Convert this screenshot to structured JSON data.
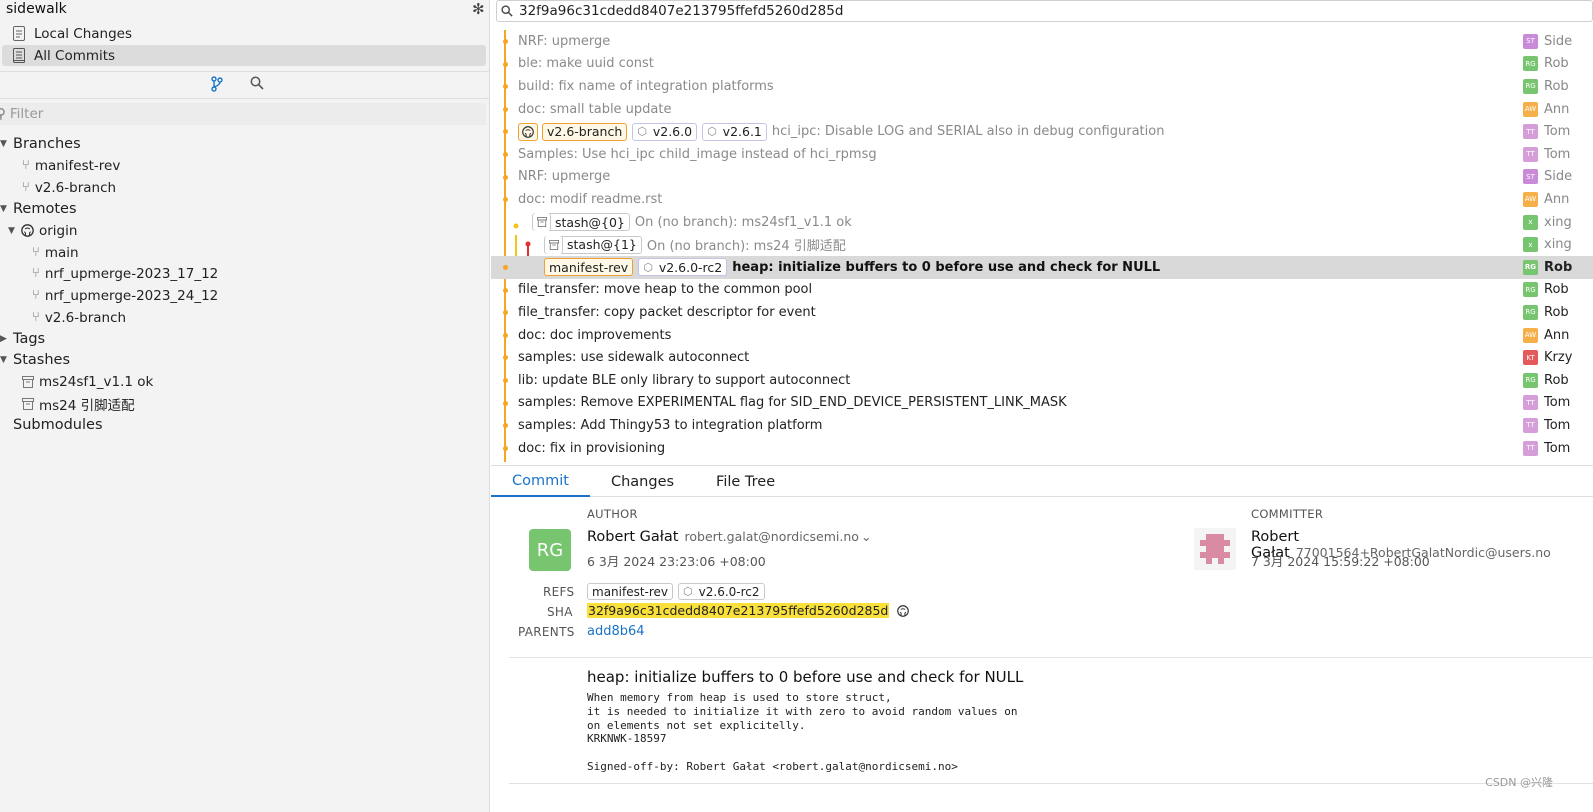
{
  "sidebar": {
    "repo_name": "sidewalk",
    "nav": [
      {
        "label": "Local Changes"
      },
      {
        "label": "All Commits"
      }
    ],
    "filter_placeholder": "Filter",
    "branches_label": "Branches",
    "branches": [
      "manifest-rev",
      "v2.6-branch"
    ],
    "remotes_label": "Remotes",
    "origin_label": "origin",
    "remote_branches": [
      "main",
      "nrf_upmerge-2023_17_12",
      "nrf_upmerge-2023_24_12",
      "v2.6-branch"
    ],
    "tags_label": "Tags",
    "stashes_label": "Stashes",
    "stashes": [
      "ms24sf1_v1.1 ok",
      "ms24 引脚适配"
    ],
    "submodules_label": "Submodules"
  },
  "search": {
    "value": "32f9a96c31cdedd8407e213795ffefd5260d285d"
  },
  "commits": [
    {
      "subject": "NRF: upmerge",
      "author": "Side",
      "initials": "ST",
      "color": "#c98bd8"
    },
    {
      "subject": "ble: make uuid const",
      "author": "Rob",
      "initials": "RG",
      "color": "#77c66f"
    },
    {
      "subject": "build: fix name of integration platforms",
      "author": "Rob",
      "initials": "RG",
      "color": "#77c66f"
    },
    {
      "subject": "doc: small table update",
      "author": "Ann",
      "initials": "AW",
      "color": "#f5b04a"
    },
    {
      "subject": "hci_ipc: Disable LOG and SERIAL also in debug configuration",
      "author": "Tom",
      "initials": "TT",
      "color": "#d59ed8",
      "refs": {
        "branch": "v2.6-branch",
        "tag1": "v2.6.0",
        "tag2": "v2.6.1"
      }
    },
    {
      "subject": "Samples: Use hci_ipc child_image instead of hci_rpmsg",
      "author": "Tom",
      "initials": "TT",
      "color": "#d59ed8"
    },
    {
      "subject": "NRF: upmerge",
      "author": "Side",
      "initials": "ST",
      "color": "#c98bd8"
    },
    {
      "subject": "doc: modif readme.rst",
      "author": "Ann",
      "initials": "AW",
      "color": "#f5b04a"
    },
    {
      "subject": "On (no branch): ms24sf1_v1.1 ok",
      "author": "xing",
      "initials": "x",
      "color": "#77c66f",
      "stash": "stash@{0}"
    },
    {
      "subject": "On (no branch): ms24 引脚适配",
      "author": "xing",
      "initials": "x",
      "color": "#77c66f",
      "stash": "stash@{1}"
    },
    {
      "subject": "heap: initialize buffers to 0 before use and check for NULL",
      "author": "Rob",
      "initials": "RG",
      "color": "#77c66f",
      "refs": {
        "branch": "manifest-rev",
        "tag1": "v2.6.0-rc2"
      }
    },
    {
      "subject": "file_transfer: move heap to the common pool",
      "author": "Rob",
      "initials": "RG",
      "color": "#77c66f"
    },
    {
      "subject": "file_transfer: copy packet descriptor for event",
      "author": "Rob",
      "initials": "RG",
      "color": "#77c66f"
    },
    {
      "subject": "doc: doc improvements",
      "author": "Ann",
      "initials": "AW",
      "color": "#f5b04a"
    },
    {
      "subject": "samples: use sidewalk autoconnect",
      "author": "Krzy",
      "initials": "KT",
      "color": "#e45a5a"
    },
    {
      "subject": "lib: update BLE only library to support autoconnect",
      "author": "Rob",
      "initials": "RG",
      "color": "#77c66f"
    },
    {
      "subject": "samples: Remove EXPERIMENTAL flag for SID_END_DEVICE_PERSISTENT_LINK_MASK",
      "author": "Tom",
      "initials": "TT",
      "color": "#d59ed8"
    },
    {
      "subject": "samples: Add Thingy53 to integration platform",
      "author": "Tom",
      "initials": "TT",
      "color": "#d59ed8"
    },
    {
      "subject": "doc: fix in provisioning",
      "author": "Tom",
      "initials": "TT",
      "color": "#d59ed8"
    }
  ],
  "tabs": [
    "Commit",
    "Changes",
    "File Tree"
  ],
  "detail": {
    "author_label": "AUTHOR",
    "committer_label": "COMMITTER",
    "author_initials": "RG",
    "author_name": "Robert Gałat",
    "author_email": "robert.galat@nordicsemi.no",
    "author_date": "6 3月 2024 23:23:06 +08:00",
    "committer_name": "Robert Gałat",
    "committer_email": "77001564+RobertGalatNordic@users.no",
    "committer_date": "7 3月 2024 15:59:22 +08:00",
    "refs_label": "REFS",
    "sha_label": "SHA",
    "parents_label": "PARENTS",
    "ref_branch": "manifest-rev",
    "ref_tag": "v2.6.0-rc2",
    "sha": "32f9a96c31cdedd8407e213795ffefd5260d285d",
    "parent": "add8b64",
    "message_title": "heap: initialize buffers to 0 before use and check for NULL",
    "message_body": "When memory from heap is used to store struct,\nit is needed to initialize it with zero to avoid random values on\non elements not set explicitelly.\nKRKNWK-18597\n\nSigned-off-by: Robert Gałat <robert.galat@nordicsemi.no>"
  },
  "watermark": "CSDN @兴隆"
}
